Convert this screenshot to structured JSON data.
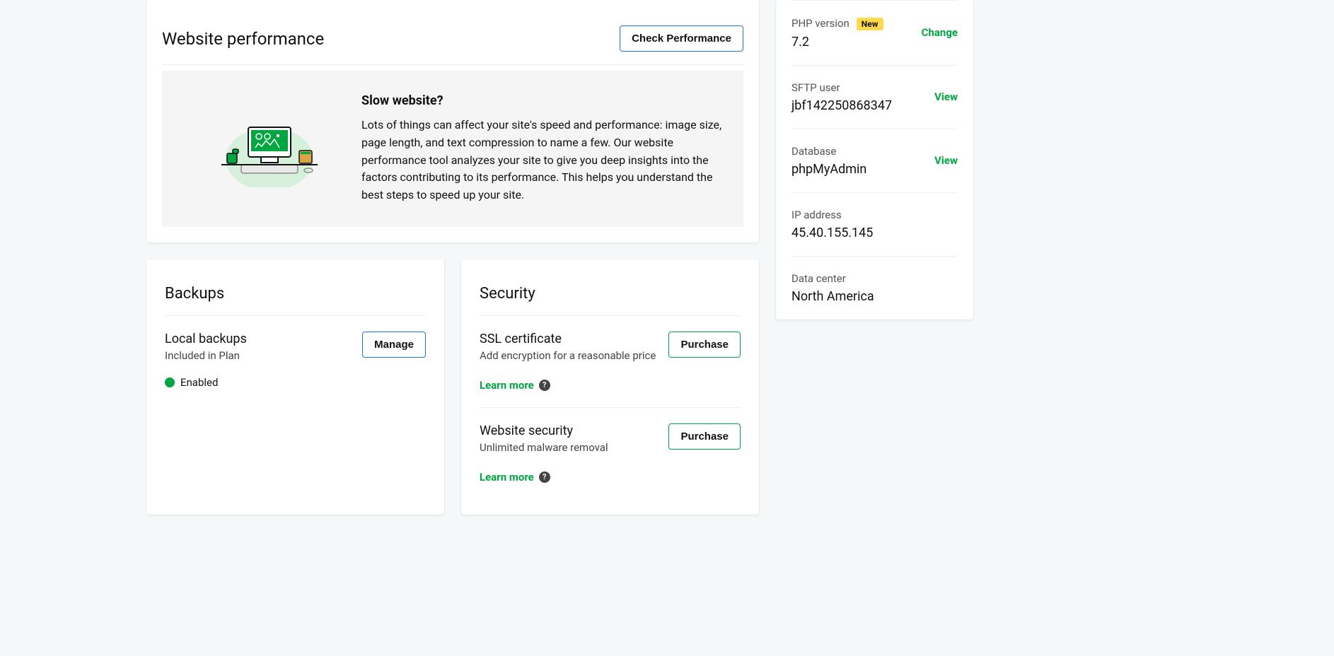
{
  "performance": {
    "title": "Website performance",
    "check_button": "Check Performance",
    "promo_title": "Slow website?",
    "promo_text": "Lots of things can affect your site's speed and performance: image size, page length, and text compression to name a few. Our website performance tool analyzes your site to give you deep insights into the factors contributing to its performance. This helps you understand the best steps to speed up your site."
  },
  "backups": {
    "title": "Backups",
    "item_title": "Local backups",
    "item_sub": "Included in Plan",
    "manage_button": "Manage",
    "status": "Enabled"
  },
  "security": {
    "title": "Security",
    "ssl": {
      "title": "SSL certificate",
      "sub": "Add encryption for a reasonable price",
      "button": "Purchase",
      "learn": "Learn more"
    },
    "websec": {
      "title": "Website security",
      "sub": "Unlimited malware removal",
      "button": "Purchase",
      "learn": "Learn more"
    }
  },
  "side": {
    "php": {
      "label": "PHP version",
      "badge": "New",
      "value": "7.2",
      "action": "Change"
    },
    "sftp": {
      "label": "SFTP user",
      "value": "jbf142250868347",
      "action": "View"
    },
    "db": {
      "label": "Database",
      "value": "phpMyAdmin",
      "action": "View"
    },
    "ip": {
      "label": "IP address",
      "value": "45.40.155.145"
    },
    "dc": {
      "label": "Data center",
      "value": "North America"
    }
  }
}
